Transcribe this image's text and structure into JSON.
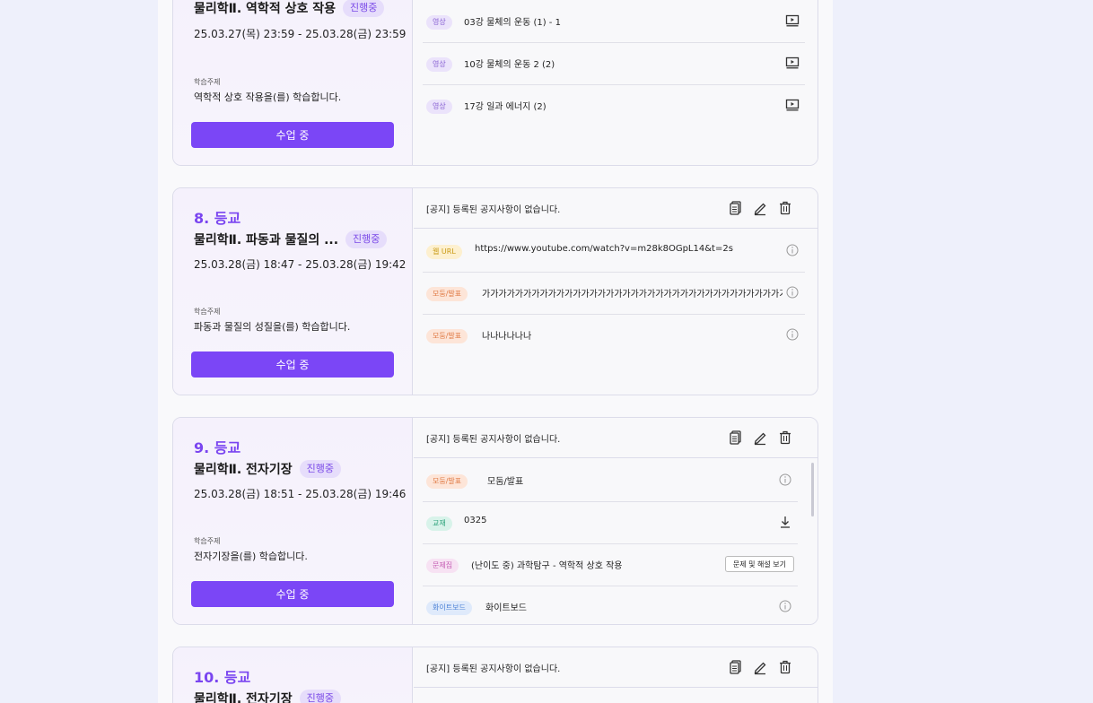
{
  "cards": [
    {
      "no": "",
      "subject": "물리학Ⅱ. 역학적 상호 작용",
      "status": "진행중",
      "period": "25.03.27(목) 23:59 - 25.03.28(금) 23:59",
      "topic_label": "학습주제",
      "topic": "역학적 상호 작용을(를) 학습합니다.",
      "button": "수업 중",
      "notice": "",
      "items": [
        {
          "tag": "영상",
          "text": "03강 물체의 운동 (1) - 1"
        },
        {
          "tag": "영상",
          "text": "10강 물체의 운동 2 (2)"
        },
        {
          "tag": "영상",
          "text": "17강 일과 에너지 (2)"
        }
      ]
    },
    {
      "no": "8. 등교",
      "subject": "물리학Ⅱ. 파동과 물질의 ...",
      "status": "진행중",
      "period": "25.03.28(금) 18:47 - 25.03.28(금) 19:42",
      "topic_label": "학습주제",
      "topic": "파동과 물질의 성질을(를) 학습합니다.",
      "button": "수업 중",
      "notice": "[공지] 등록된 공지사항이 없습니다.",
      "items": [
        {
          "tag": "웹 URL",
          "text": "https://www.youtube.com/watch?v=m28k8OGpL14&t=2s"
        },
        {
          "tag": "모둠/발표",
          "text": "가가가가가가가가가가가가가가가가가가가가가가가가가가가가가가가가가가가가가가가가가가가..."
        },
        {
          "tag": "모둠/발표",
          "text": "나나나나나나"
        }
      ]
    },
    {
      "no": "9. 등교",
      "subject": "물리학Ⅱ. 전자기장",
      "status": "진행중",
      "period": "25.03.28(금) 18:51 - 25.03.28(금) 19:46",
      "topic_label": "학습주제",
      "topic": "전자기장을(를) 학습합니다.",
      "button": "수업 중",
      "notice": "[공지] 등록된 공지사항이 없습니다.",
      "items": [
        {
          "tag": "모둠/발표",
          "text": "모둠/발표"
        },
        {
          "tag": "교재",
          "text": "0325"
        },
        {
          "tag": "문제집",
          "text": "(난이도 중) 과학탐구 - 역학적 상호 작용",
          "action": "문제 및 해설 보기"
        },
        {
          "tag": "화이트보드",
          "text": "화이트보드"
        }
      ]
    },
    {
      "no": "10. 등교",
      "subject": "물리학Ⅱ. 전자기장",
      "status": "진행중",
      "notice": "[공지] 등록된 공지사항이 없습니다."
    }
  ],
  "icons": {
    "video": "play-screen-icon",
    "info": "info-circle-icon",
    "download": "download-icon",
    "copy": "copy-icon",
    "edit": "pencil-icon",
    "delete": "trash-icon"
  },
  "colors": {
    "accent": "#7b46f6",
    "session_number": "#7a45f0",
    "badge_bg": "#e6ddfb"
  }
}
